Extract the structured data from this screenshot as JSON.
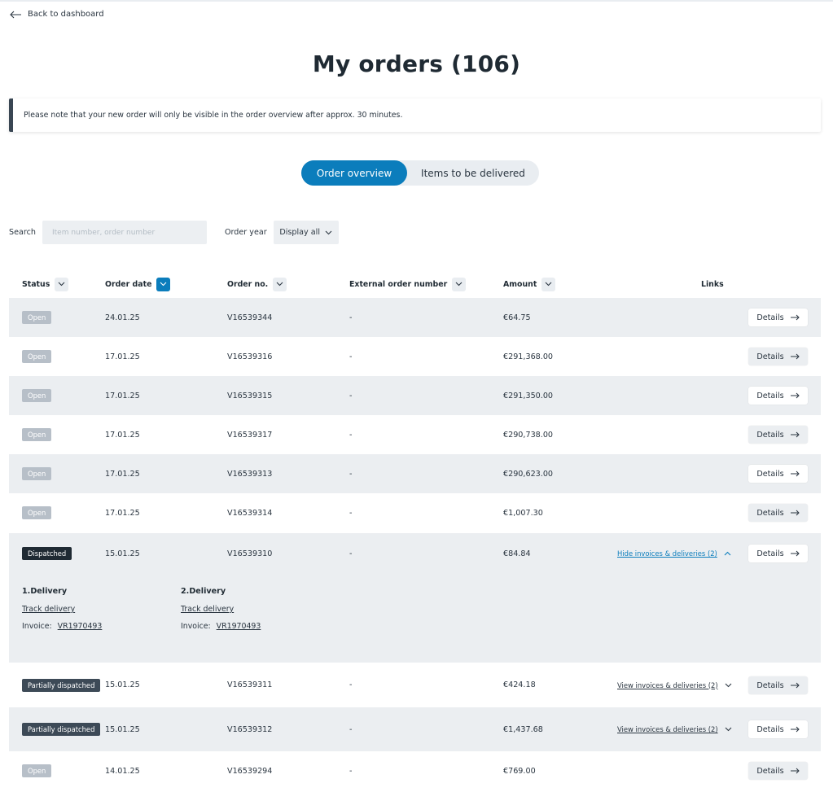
{
  "nav": {
    "back_label": "Back to dashboard"
  },
  "page": {
    "title": "My orders (106)"
  },
  "notice": {
    "text": "Please note that your new order will only be visible in the order overview after approx. 30 minutes."
  },
  "tabs": {
    "overview": "Order overview",
    "items": "Items to be delivered"
  },
  "filters": {
    "search_label": "Search",
    "search_placeholder": "Item number, order number",
    "year_label": "Order year",
    "year_value": "Display all"
  },
  "table": {
    "headers": {
      "status": "Status",
      "date": "Order date",
      "order_no": "Order no.",
      "external": "External order number",
      "amount": "Amount",
      "links": "Links"
    },
    "details_label": "Details",
    "rows": [
      {
        "status": "Open",
        "date": "24.01.25",
        "order_no": "V16539344",
        "external": "-",
        "amount": "€64.75"
      },
      {
        "status": "Open",
        "date": "17.01.25",
        "order_no": "V16539316",
        "external": "-",
        "amount": "€291,368.00"
      },
      {
        "status": "Open",
        "date": "17.01.25",
        "order_no": "V16539315",
        "external": "-",
        "amount": "€291,350.00"
      },
      {
        "status": "Open",
        "date": "17.01.25",
        "order_no": "V16539317",
        "external": "-",
        "amount": "€290,738.00"
      },
      {
        "status": "Open",
        "date": "17.01.25",
        "order_no": "V16539313",
        "external": "-",
        "amount": "€290,623.00"
      },
      {
        "status": "Open",
        "date": "17.01.25",
        "order_no": "V16539314",
        "external": "-",
        "amount": "€1,007.30"
      },
      {
        "status": "Dispatched",
        "date": "15.01.25",
        "order_no": "V16539310",
        "external": "-",
        "amount": "€84.84",
        "link": "Hide invoices & deliveries (2)"
      },
      {
        "status": "Partially dispatched",
        "date": "15.01.25",
        "order_no": "V16539311",
        "external": "-",
        "amount": "€424.18",
        "link": "View invoices & deliveries (2)"
      },
      {
        "status": "Partially dispatched",
        "date": "15.01.25",
        "order_no": "V16539312",
        "external": "-",
        "amount": "€1,437.68",
        "link": "View invoices & deliveries (2)"
      },
      {
        "status": "Open",
        "date": "14.01.25",
        "order_no": "V16539294",
        "external": "-",
        "amount": "€769.00"
      }
    ],
    "expanded": {
      "deliveries": [
        {
          "title": "1.Delivery",
          "track": "Track delivery",
          "invoice_label": "Invoice:",
          "invoice": "VR1970493"
        },
        {
          "title": "2.Delivery",
          "track": "Track delivery",
          "invoice_label": "Invoice:",
          "invoice": "VR1970493"
        }
      ]
    }
  },
  "colors": {
    "accent": "#0b7dbc",
    "row_grey": "#ebeef1",
    "badge_open": "#b7bfc8",
    "badge_dark": "#1f2a33"
  }
}
